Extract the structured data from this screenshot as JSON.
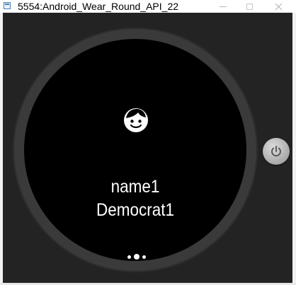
{
  "window": {
    "title": "5554:Android_Wear_Round_API_22",
    "icons": {
      "app": "emulator-app-icon",
      "minimize": "minimize-icon",
      "maximize": "maximize-icon",
      "close": "close-icon"
    }
  },
  "watch": {
    "icon": "face-icon",
    "line1": "name1",
    "line2": "Democrat1",
    "pager": {
      "pages": 3,
      "active_index": 1
    }
  },
  "hardware": {
    "power_icon": "power-icon"
  },
  "colors": {
    "client_background": "#232323",
    "bezel": "#3a3a3a",
    "screen": "#000000",
    "text": "#ffffff"
  }
}
